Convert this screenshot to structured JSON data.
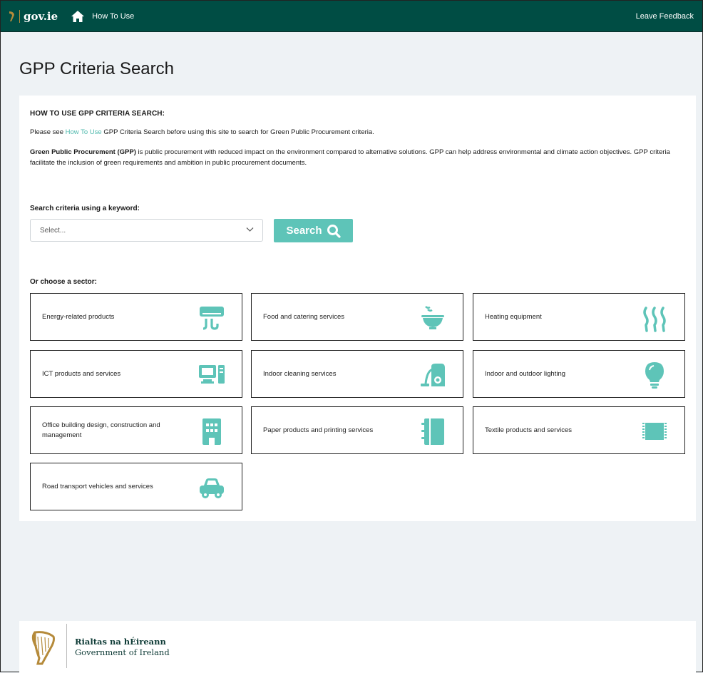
{
  "topbar": {
    "logo_text": "gov.ie",
    "howto_label": "How To Use",
    "feedback_label": "Leave Feedback",
    "bg_color": "#004d44"
  },
  "page": {
    "title": "GPP Criteria Search"
  },
  "intro": {
    "heading": "HOW TO USE GPP CRITERIA SEARCH:",
    "line_prefix": "Please see ",
    "line_link": "How To Use",
    "line_suffix": " GPP Criteria Search before using this site to search for Green Public Procurement criteria.",
    "gpp_bold": "Green Public Procurement (GPP)",
    "gpp_text": " is public procurement with reduced impact on the environment compared to alternative solutions. GPP can help address environmental and climate action objectives. GPP criteria facilitate the inclusion of green requirements and ambition in public procurement documents."
  },
  "search": {
    "label": "Search criteria using a keyword:",
    "placeholder": "Select...",
    "button_label": "Search",
    "accent_color": "#5ec4b8"
  },
  "sectors": {
    "label": "Or choose a sector:",
    "items": [
      {
        "label": "Energy-related products",
        "icon": "air-conditioner-icon"
      },
      {
        "label": "Food and catering services",
        "icon": "food-bowl-icon"
      },
      {
        "label": "Heating equipment",
        "icon": "heat-waves-icon"
      },
      {
        "label": "ICT products and services",
        "icon": "computer-icon"
      },
      {
        "label": "Indoor cleaning services",
        "icon": "vacuum-cleaner-icon"
      },
      {
        "label": "Indoor and outdoor lighting",
        "icon": "lightbulb-icon"
      },
      {
        "label": "Office building design, construction and management",
        "icon": "office-building-icon"
      },
      {
        "label": "Paper products and printing services",
        "icon": "notebook-icon"
      },
      {
        "label": "Textile products and services",
        "icon": "textile-icon"
      },
      {
        "label": "Road transport vehicles and services",
        "icon": "car-icon"
      }
    ]
  },
  "footer": {
    "irish_name": "Rialtas na hÉireann",
    "english_name": "Government of Ireland"
  }
}
